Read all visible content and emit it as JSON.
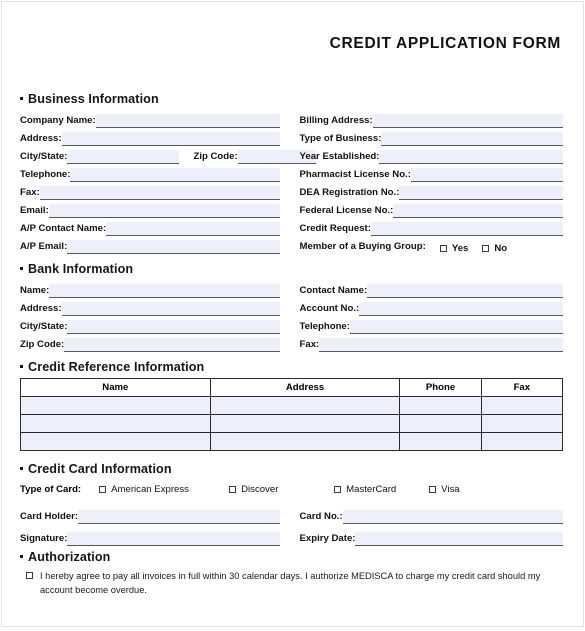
{
  "document": {
    "title": "CREDIT APPLICATION FORM"
  },
  "business": {
    "heading": "Business Information",
    "left": [
      {
        "label": "Company Name:"
      },
      {
        "label": "Address:"
      },
      {
        "label": "City/State:"
      },
      {
        "label": "Telephone:"
      },
      {
        "label": "Fax:"
      },
      {
        "label": "Email:"
      },
      {
        "label": "A/P Contact Name:"
      },
      {
        "label": "A/P Email:"
      }
    ],
    "zip_label": "Zip Code:",
    "right": [
      {
        "label": "Billing Address:"
      },
      {
        "label": "Type of Business:"
      },
      {
        "label": "Year Established:"
      },
      {
        "label": "Pharmacist License No.:"
      },
      {
        "label": "DEA Registration No.:"
      },
      {
        "label": "Federal License No.:"
      },
      {
        "label": "Credit Request:"
      }
    ],
    "buying_group": {
      "label": "Member of a Buying Group:",
      "yes": "Yes",
      "no": "No"
    }
  },
  "bank": {
    "heading": "Bank Information",
    "left": [
      {
        "label": "Name:"
      },
      {
        "label": "Address:"
      },
      {
        "label": "City/State:"
      },
      {
        "label": "Zip Code:"
      }
    ],
    "right": [
      {
        "label": "Contact Name:"
      },
      {
        "label": "Account No.:"
      },
      {
        "label": "Telephone:"
      },
      {
        "label": "Fax:"
      }
    ]
  },
  "credit_reference": {
    "heading": "Credit Reference Information",
    "columns": [
      "Name",
      "Address",
      "Phone",
      "Fax"
    ],
    "rows": [
      [
        "",
        "",
        "",
        ""
      ],
      [
        "",
        "",
        "",
        ""
      ],
      [
        "",
        "",
        "",
        ""
      ]
    ]
  },
  "credit_card": {
    "heading": "Credit Card Information",
    "type_label": "Type of Card:",
    "types": [
      "American Express",
      "Discover",
      "MasterCard",
      "Visa"
    ],
    "left": [
      {
        "label": "Card Holder:"
      },
      {
        "label": "Signature:"
      }
    ],
    "right": [
      {
        "label": "Card No.:"
      },
      {
        "label": "Expiry Date:"
      }
    ]
  },
  "authorization": {
    "heading": "Authorization",
    "statement": "I hereby agree to pay all invoices in full within 30 calendar days. I authorize MEDISCA to charge my credit card should my account become overdue."
  },
  "colors": {
    "field_fill": "#edf0fa",
    "field_rule": "#58585a",
    "text": "#111111"
  }
}
